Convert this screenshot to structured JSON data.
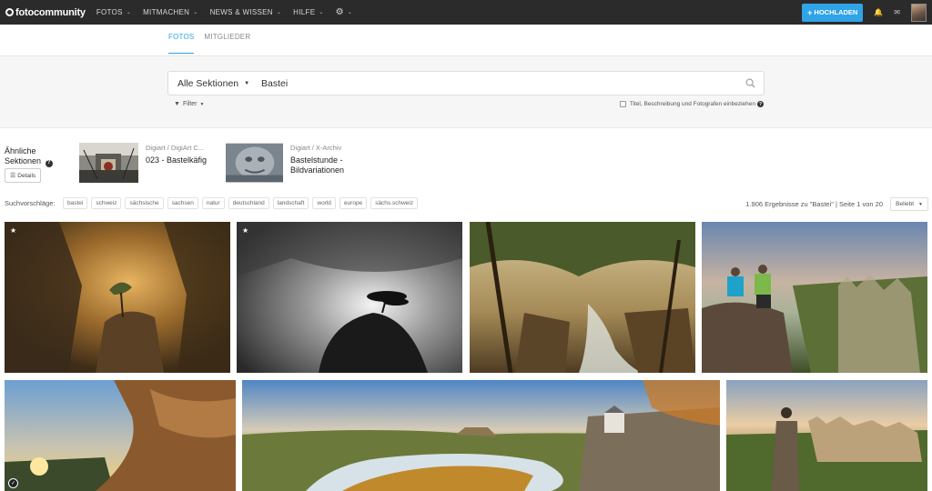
{
  "app": {
    "logo_text": "fotocommunity"
  },
  "nav": {
    "items": [
      {
        "label": "FOTOS"
      },
      {
        "label": "MITMACHEN"
      },
      {
        "label": "NEWS & WISSEN"
      },
      {
        "label": "HILFE"
      }
    ],
    "settings_icon": "gear-icon",
    "upload_label": "HOCHLADEN",
    "bell_icon": "bell-icon",
    "mail_icon": "envelope-icon"
  },
  "tabs": [
    {
      "label": "FOTOS",
      "active": true
    },
    {
      "label": "MITGLIEDER",
      "active": false
    }
  ],
  "search": {
    "section_label": "Alle Sektionen",
    "query": "Bastei",
    "filter_label": "Filter",
    "checkbox_label": "Titel, Beschreibung und Fotografen einbeziehen"
  },
  "similar": {
    "label_line1": "Ähnliche",
    "label_line2": "Sektionen",
    "details_label": "Details",
    "cards": [
      {
        "path": "Digiart / DigiArt C...",
        "title": "023 - Bastelkäfig"
      },
      {
        "path": "Digiart / X-Archiv",
        "title": "Bastelstunde - Bildvariationen"
      }
    ]
  },
  "suggestions": {
    "label": "Suchvorschläge:",
    "tags": [
      "bastei",
      "schweiz",
      "sächsische",
      "sachsen",
      "natur",
      "deutschland",
      "landschaft",
      "world",
      "europe",
      "sächs.schweiz"
    ]
  },
  "results_text": "1.906 Ergebnisse zu \"Bastei\" | Seite 1 von 20",
  "sort_label": "Beliebt",
  "accent_color": "#2fa4e7"
}
